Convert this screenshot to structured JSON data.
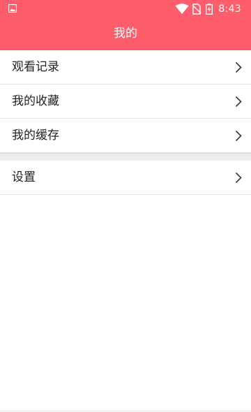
{
  "status_bar": {
    "time": "8:43",
    "icons": [
      "image-notification-icon",
      "wifi-icon",
      "no-sim-icon",
      "battery-charging-icon"
    ]
  },
  "toolbar": {
    "title": "我的"
  },
  "menu": {
    "group1": [
      {
        "label": "观看记录"
      },
      {
        "label": "我的收藏"
      },
      {
        "label": "我的缓存"
      }
    ],
    "group2": [
      {
        "label": "设置"
      }
    ]
  },
  "colors": {
    "accent": "#fe5d6b",
    "divider": "#ececec",
    "text": "#222222"
  }
}
